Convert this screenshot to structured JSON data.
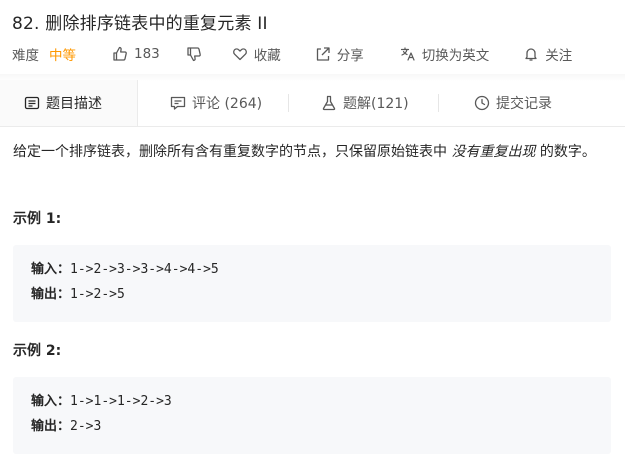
{
  "problem": {
    "title": "82. 删除排序链表中的重复元素 II"
  },
  "actions": {
    "difficulty_label": "难度",
    "difficulty_value": "中等",
    "like_count": "183",
    "favorite_label": "收藏",
    "share_label": "分享",
    "translate_label": "切换为英文",
    "follow_label": "关注"
  },
  "tabs": [
    {
      "label": "题目描述"
    },
    {
      "label": "评论 (264)"
    },
    {
      "label": "题解(121)"
    },
    {
      "label": "提交记录"
    }
  ],
  "description": {
    "text_before": "给定一个排序链表，删除所有含有重复数字的节点，只保留原始链表中 ",
    "emphasis": "没有重复出现",
    "text_after": " 的数字。"
  },
  "examples": [
    {
      "title": "示例 1:",
      "input_label": "输入：",
      "input": "1->2->3->3->4->4->5",
      "output_label": "输出：",
      "output": "1->2->5"
    },
    {
      "title": "示例 2:",
      "input_label": "输入：",
      "input": "1->1->1->2->3",
      "output_label": "输出：",
      "output": "2->3"
    }
  ],
  "colors": {
    "difficulty_medium": "#ff9800",
    "code_background": "#f7f8fa"
  }
}
